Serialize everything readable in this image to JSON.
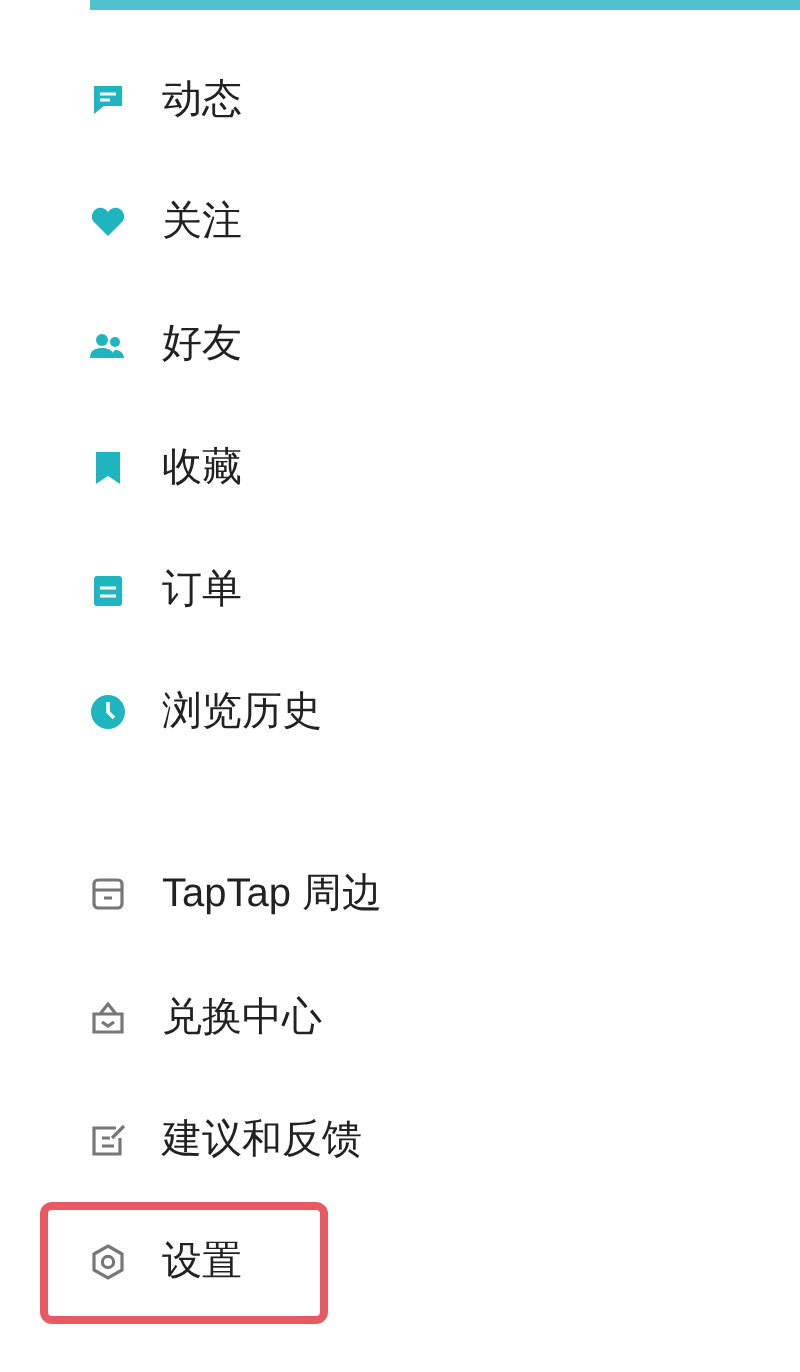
{
  "sections": [
    {
      "kind": "primary",
      "items": [
        {
          "label": "动态",
          "highlighted": false
        },
        {
          "label": "关注",
          "highlighted": false
        },
        {
          "label": "好友",
          "highlighted": false
        },
        {
          "label": "收藏",
          "highlighted": false
        },
        {
          "label": "订单",
          "highlighted": false
        },
        {
          "label": "浏览历史",
          "highlighted": false
        }
      ]
    },
    {
      "kind": "secondary",
      "items": [
        {
          "label": "TapTap 周边",
          "highlighted": false
        },
        {
          "label": "兑换中心",
          "highlighted": false
        },
        {
          "label": "建议和反馈",
          "highlighted": false
        },
        {
          "label": "设置",
          "highlighted": true
        }
      ]
    }
  ]
}
